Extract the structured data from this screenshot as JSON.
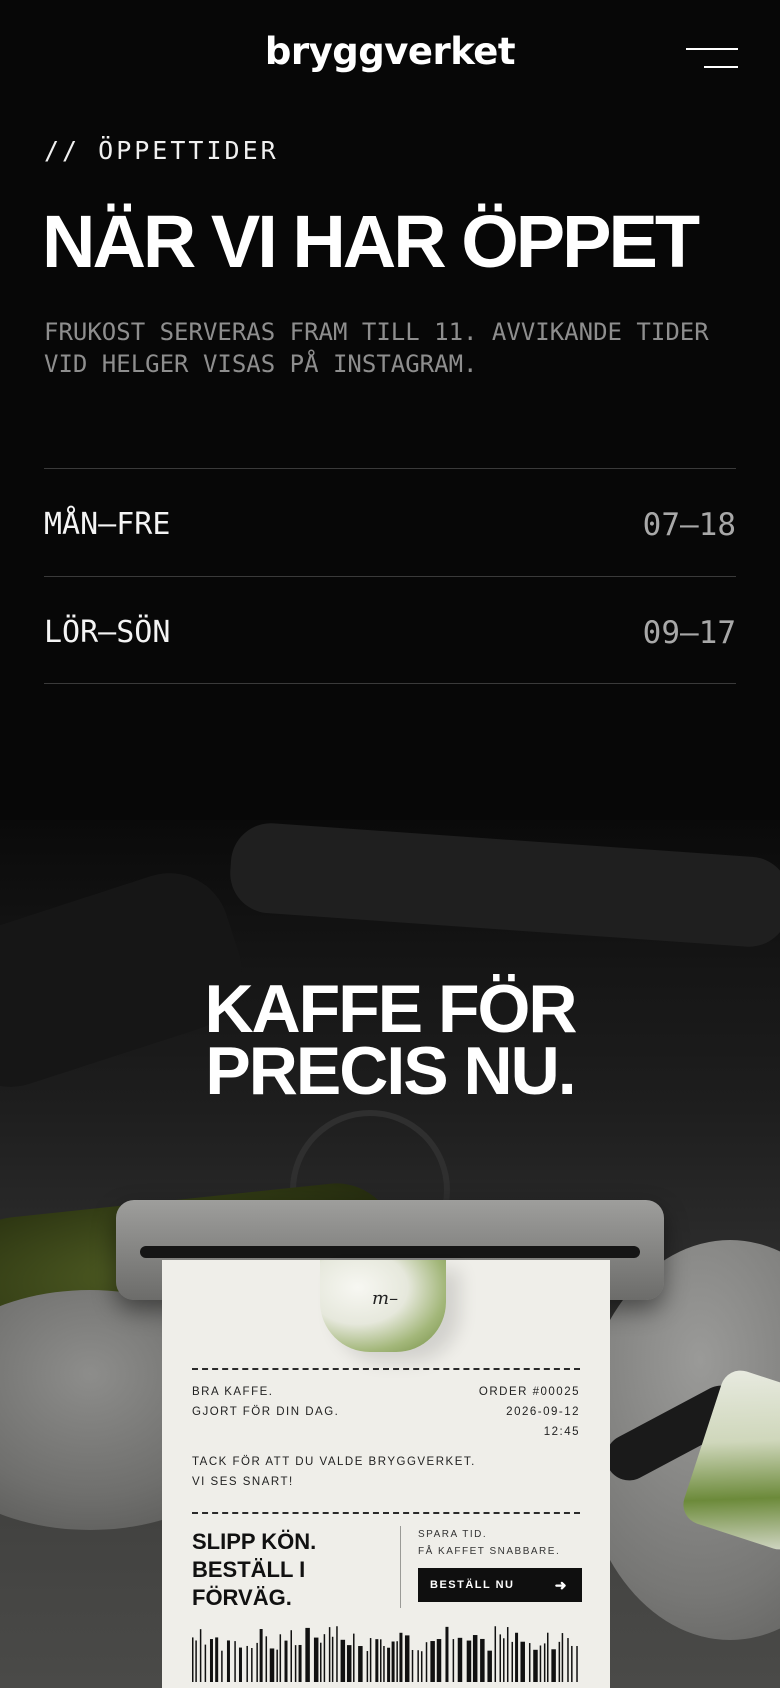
{
  "header": {
    "logo": "bryggverket",
    "menu_icon": "hamburger-menu-icon"
  },
  "hours": {
    "eyebrow": "// ÖPPETTIDER",
    "title": "NÄR VI HAR ÖPPET",
    "description": "FRUKOST SERVERAS FRAM TILL 11. AVVIKANDE TIDER VID HELGER VISAS PÅ INSTAGRAM.",
    "rows": [
      {
        "day": "MÅN–FRE",
        "time": "07–18"
      },
      {
        "day": "LÖR–SÖN",
        "time": "09–17"
      }
    ]
  },
  "hero": {
    "title_line1": "KAFFE FÖR",
    "title_line2": "PRECIS NU."
  },
  "receipt": {
    "left_line1": "BRA KAFFE.",
    "left_line2": "GJORT FÖR DIN DAG.",
    "order": "ORDER #00025",
    "date": "2026-09-12",
    "time": "12:45",
    "thanks_line1": "TACK FÖR ATT DU VALDE BRYGGVERKET.",
    "thanks_line2": "VI SES SNART!",
    "cta_line1": "SLIPP KÖN.",
    "cta_line2": "BESTÄLL I",
    "cta_line3": "FÖRVÄG.",
    "sub_line1": "SPARA TID.",
    "sub_line2": "FÅ KAFFET SNABBARE.",
    "button_label": "BESTÄLL NU",
    "button_icon": "arrow-right-icon"
  },
  "colors": {
    "background": "#070707",
    "receipt_paper": "#efeee9",
    "muted_text": "#8e8e8e",
    "divider": "#3a3a3a"
  }
}
